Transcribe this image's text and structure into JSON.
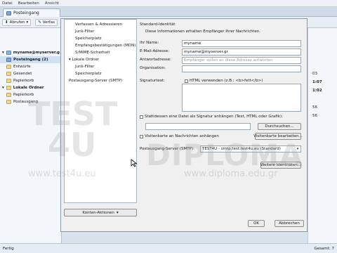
{
  "menubar": {
    "items": [
      "Datei",
      "Bearbeiten",
      "Ansicht"
    ]
  },
  "tab": {
    "label": "Posteingang"
  },
  "toolbar": {
    "get_mail_label": "Abrufen",
    "compose_label": "Verfas"
  },
  "folderpane": {
    "items": [
      {
        "label": "myname@myserver.g",
        "kind": "account"
      },
      {
        "label": "Posteingang (2)",
        "kind": "inbox",
        "selected": true
      },
      {
        "label": "Entwürfe",
        "kind": "folder"
      },
      {
        "label": "Gesendet",
        "kind": "folder"
      },
      {
        "label": "Papierkorb",
        "kind": "folder"
      },
      {
        "label": "Lokale Ordner",
        "kind": "account"
      },
      {
        "label": "Papierkorb",
        "kind": "folder"
      },
      {
        "label": "Postausgang",
        "kind": "folder"
      }
    ]
  },
  "rightstrip": {
    "items": [
      "03",
      "1:07",
      "1:02",
      "56",
      "56"
    ]
  },
  "statusbar": {
    "left": "Fertig",
    "right": "Gesamt: 7"
  },
  "dialog": {
    "tree": [
      {
        "label": "Verfassen & Adressieren",
        "level": 1
      },
      {
        "label": "Junk-Filter",
        "level": 1
      },
      {
        "label": "Speicherplatz",
        "level": 1
      },
      {
        "label": "Empfangsbestätigungen (MDN)",
        "level": 1
      },
      {
        "label": "S/MIME-Sicherheit",
        "level": 1
      },
      {
        "label": "Lokale Ordner",
        "level": 0
      },
      {
        "label": "Junk-Filter",
        "level": 1
      },
      {
        "label": "Speicherplatz",
        "level": 1
      },
      {
        "label": "Postausgang-Server (SMTP)",
        "level": 0
      }
    ],
    "account_actions_label": "Konten-Aktionen",
    "identity": {
      "title": "Standard-Identität",
      "description": "Diese Informationen erhalten Empfänger Ihrer Nachrichten.",
      "name_label": "Ihr Name:",
      "name_value": "myname",
      "email_label": "E-Mail-Adresse:",
      "email_value": "myname@myserver.gr",
      "reply_label": "Antwortadresse:",
      "reply_placeholder": "Empfänger sollen an diese Adresse antworten",
      "org_label": "Organisation:",
      "org_value": "",
      "sig_label": "Signaturtext:",
      "html_label": "HTML verwenden (z.B.: <b>fett</b>)",
      "attach_file_label": "Stattdessen eine Datei als Signatur anhängen (Text, HTML oder Grafik):",
      "browse_label": "Durchsuchen...",
      "vcard_label": "Visitenkarte an Nachrichten anhängen",
      "vcard_edit_label": "Visitenkarte bearbeiten...",
      "smtp_label": "Postausgang-Server (SMTP):",
      "smtp_value": "TEST4U - smtp.test.test4u.eu (Standard)",
      "more_identities_label": "Weitere Identitäten..."
    },
    "ok_label": "OK",
    "cancel_label": "Abbrechen"
  },
  "watermark": {
    "line1": "TEST",
    "line2": "4U",
    "url1": "www.test4u.eu",
    "brand2": "DIPLOMA",
    "url2": "www.diploma.edu.gr"
  }
}
